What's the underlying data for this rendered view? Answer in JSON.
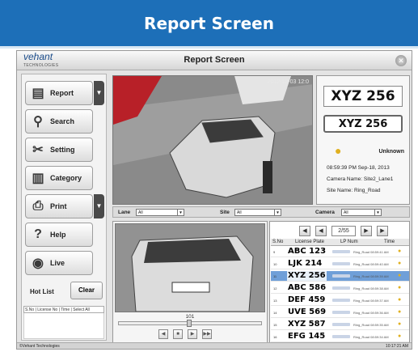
{
  "banner": {
    "title": "Report Screen"
  },
  "window": {
    "logo": "vehant",
    "logo_sub": "TECHNOLOGIES",
    "title": "Report Screen"
  },
  "sidebar": {
    "items": [
      {
        "label": "Report",
        "icon": "report-icon",
        "dropdown": true
      },
      {
        "label": "Search",
        "icon": "search-icon",
        "dropdown": false
      },
      {
        "label": "Setting",
        "icon": "tools-icon",
        "dropdown": false
      },
      {
        "label": "Category",
        "icon": "category-icon",
        "dropdown": false
      },
      {
        "label": "Print",
        "icon": "printer-icon",
        "dropdown": true
      },
      {
        "label": "Help",
        "icon": "help-icon",
        "dropdown": false
      },
      {
        "label": "Live",
        "icon": "camera-icon",
        "dropdown": false
      }
    ],
    "hot_list_label": "Hot List",
    "clear_label": "Clear",
    "hot_list_columns": "S.No | License No | Time | Select All"
  },
  "main": {
    "timestamp": "2012-12-03 12:0"
  },
  "info": {
    "plate_big": "XYZ 256",
    "plate_small": "XYZ 256",
    "status": "Unknown",
    "datetime": "08:59:39 PM Sep-18, 2013",
    "camera": "Camera Name: Site2_Lane1",
    "site": "Site Name: Ring_Road"
  },
  "filters": {
    "lane_label": "Lane",
    "lane_value": "All",
    "site_label": "Site",
    "site_value": "All",
    "camera_label": "Camera",
    "camera_value": "All"
  },
  "thumb": {
    "counter": "101"
  },
  "list": {
    "page": "2/55",
    "columns": {
      "sno": "S.No",
      "plate": "License Plate",
      "lp": "LP Num",
      "time": "Time"
    },
    "rows": [
      {
        "no": "9",
        "plate": "ABC 123",
        "time": "Ring_Road  08:59:41 AM",
        "selected": false
      },
      {
        "no": "10",
        "plate": "LJK  214",
        "time": "Ring_Road  08:59:40 AM",
        "selected": false
      },
      {
        "no": "11",
        "plate": "XYZ 256",
        "time": "Ring_Road  08:59:39 AM",
        "selected": true
      },
      {
        "no": "12",
        "plate": "ABC 586",
        "time": "Ring_Road  08:59:38 AM",
        "selected": false
      },
      {
        "no": "13",
        "plate": "DEF 459",
        "time": "Ring_Road  08:59:37 AM",
        "selected": false
      },
      {
        "no": "14",
        "plate": "UVE 569",
        "time": "Ring_Road  08:59:36 AM",
        "selected": false
      },
      {
        "no": "15",
        "plate": "XYZ 587",
        "time": "Ring_Road  08:59:35 AM",
        "selected": false
      },
      {
        "no": "16",
        "plate": "EFG 145",
        "time": "Ring_Road  08:59:34 AM",
        "selected": false
      }
    ]
  },
  "status": {
    "left": "©Vehant Technologies",
    "right": "10:17:21 AM"
  },
  "colors": {
    "banner": "#1d6fb8",
    "selected_row": "#6f9fd8",
    "accent_icon": "#e0b020"
  }
}
